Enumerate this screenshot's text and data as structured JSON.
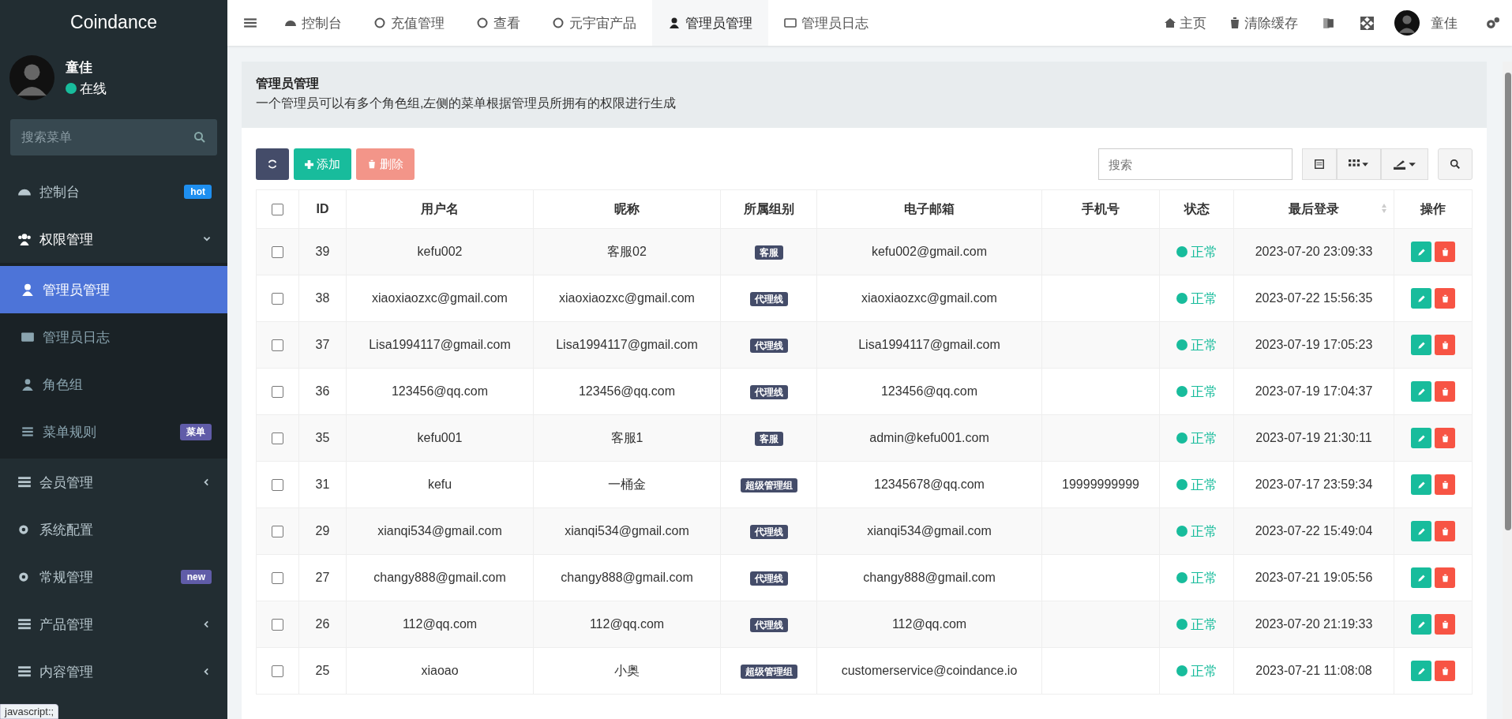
{
  "sidebar": {
    "brand": "Coindance",
    "user": {
      "name": "童佳",
      "status": "在线"
    },
    "search": {
      "placeholder": "搜索菜单"
    },
    "items": [
      {
        "label": "控制台",
        "badge": "hot",
        "color": "#1e8ff0"
      },
      {
        "label": "权限管理",
        "expanded": true,
        "children": [
          {
            "label": "管理员管理",
            "selected": true
          },
          {
            "label": "管理员日志",
            "selected": false
          },
          {
            "label": "角色组",
            "selected": false
          },
          {
            "label": "菜单规则",
            "selected": false,
            "badge": "菜单",
            "color": "#605ca8"
          }
        ]
      },
      {
        "label": "会员管理",
        "expanded": false
      },
      {
        "label": "系统配置"
      },
      {
        "label": "常规管理",
        "badge": "new",
        "color": "#605ca8"
      },
      {
        "label": "产品管理",
        "expanded": false
      },
      {
        "label": "内容管理",
        "expanded": false
      }
    ]
  },
  "status_tooltip": "javascript:;",
  "topbar": {
    "tabs": [
      {
        "label": "控制台",
        "selected": false
      },
      {
        "label": "充值管理",
        "selected": false
      },
      {
        "label": "查看",
        "selected": false
      },
      {
        "label": "元宇宙产品",
        "selected": false
      },
      {
        "label": "管理员管理",
        "selected": true
      },
      {
        "label": "管理员日志",
        "selected": false
      }
    ],
    "links": [
      "主页",
      "清除缓存"
    ],
    "user": "童佳"
  },
  "panel": {
    "title": "管理员管理",
    "description": "一个管理员可以有多个角色组,左侧的菜单根据管理员所拥有的权限进行生成"
  },
  "toolbar": {
    "add": "添加",
    "delete": "删除",
    "search": {
      "placeholder": "搜索"
    }
  },
  "table": {
    "select_all": {
      "checked": false
    },
    "columns": [
      "ID",
      "用户名",
      "昵称",
      "所属组别",
      "电子邮箱",
      "手机号",
      "状态",
      "最后登录",
      "操作"
    ],
    "rows": [
      {
        "checked": false,
        "id": "39",
        "username": "kefu002",
        "nickname": "客服02",
        "group": "客服",
        "email": "kefu002@gmail.com",
        "phone": "",
        "status": "正常",
        "last_login": "2023-07-20 23:09:33"
      },
      {
        "checked": false,
        "id": "38",
        "username": "xiaoxiaozxc@gmail.com",
        "nickname": "xiaoxiaozxc@gmail.com",
        "group": "代理线",
        "email": "xiaoxiaozxc@gmail.com",
        "phone": "",
        "status": "正常",
        "last_login": "2023-07-22 15:56:35"
      },
      {
        "checked": false,
        "id": "37",
        "username": "Lisa1994117@gmail.com",
        "nickname": "Lisa1994117@gmail.com",
        "group": "代理线",
        "email": "Lisa1994117@gmail.com",
        "phone": "",
        "status": "正常",
        "last_login": "2023-07-19 17:05:23"
      },
      {
        "checked": false,
        "id": "36",
        "username": "123456@qq.com",
        "nickname": "123456@qq.com",
        "group": "代理线",
        "email": "123456@qq.com",
        "phone": "",
        "status": "正常",
        "last_login": "2023-07-19 17:04:37"
      },
      {
        "checked": false,
        "id": "35",
        "username": "kefu001",
        "nickname": "客服1",
        "group": "客服",
        "email": "admin@kefu001.com",
        "phone": "",
        "status": "正常",
        "last_login": "2023-07-19 21:30:11"
      },
      {
        "checked": false,
        "id": "31",
        "username": "kefu",
        "nickname": "一桶金",
        "group": "超级管理组",
        "email": "12345678@qq.com",
        "phone": "19999999999",
        "status": "正常",
        "last_login": "2023-07-17 23:59:34"
      },
      {
        "checked": false,
        "id": "29",
        "username": "xianqi534@gmail.com",
        "nickname": "xianqi534@gmail.com",
        "group": "代理线",
        "email": "xianqi534@gmail.com",
        "phone": "",
        "status": "正常",
        "last_login": "2023-07-22 15:49:04"
      },
      {
        "checked": false,
        "id": "27",
        "username": "changy888@gmail.com",
        "nickname": "changy888@gmail.com",
        "group": "代理线",
        "email": "changy888@gmail.com",
        "phone": "",
        "status": "正常",
        "last_login": "2023-07-21 19:05:56"
      },
      {
        "checked": false,
        "id": "26",
        "username": "112@qq.com",
        "nickname": "112@qq.com",
        "group": "代理线",
        "email": "112@qq.com",
        "phone": "",
        "status": "正常",
        "last_login": "2023-07-20 21:19:33"
      },
      {
        "checked": false,
        "id": "25",
        "username": "xiaoao",
        "nickname": "小奥",
        "group": "超级管理组",
        "email": "customerservice@coindance.io",
        "phone": "",
        "status": "正常",
        "last_login": "2023-07-21 11:08:08"
      }
    ]
  }
}
